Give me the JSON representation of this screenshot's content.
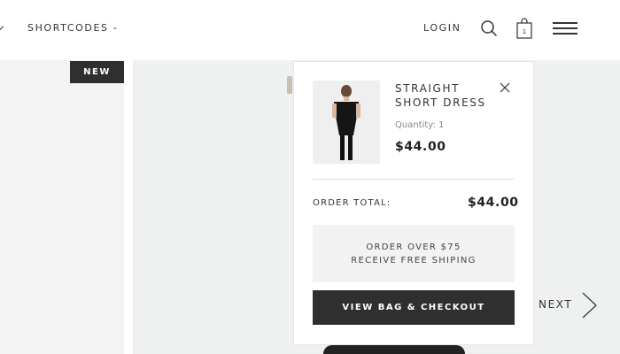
{
  "header": {
    "nav_item": "SHORTCODES",
    "login_label": "LOGIN",
    "bag_count": "1"
  },
  "badge": {
    "new_label": "NEW"
  },
  "cart": {
    "product_name": "STRAIGHT SHORT DRESS",
    "quantity_text": "Quantity: 1",
    "price": "$44.00",
    "order_total_label": "ORDER TOTAL:",
    "order_total_value": "$44.00",
    "promo_line1": "ORDER OVER $75",
    "promo_line2": "RECEIVE FREE SHIPING",
    "checkout_label": "VIEW BAG & CHECKOUT"
  },
  "slider": {
    "next_label": "NEXT"
  },
  "colors": {
    "dark": "#2f2f2f",
    "panel_bg": "#eff0f0",
    "promo_bg": "#f2f2f2"
  }
}
